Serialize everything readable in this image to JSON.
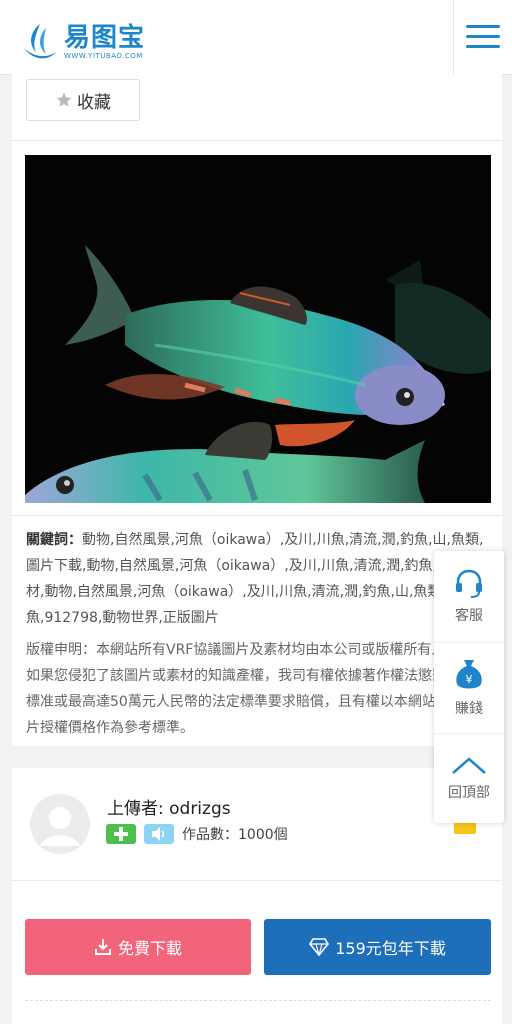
{
  "header": {
    "logo_cn": "易图宝",
    "logo_en": "WWW.YITUBAO.COM"
  },
  "favorite": {
    "label": "收藏"
  },
  "image_info": {
    "keywords_label": "關鍵詞：",
    "keywords_text": "動物,自然風景,河魚（oikawa）,及川,川魚,清流,潤,釣魚,山,魚類,圖片下載,動物,自然風景,河魚（oikawa）,及川,川魚,清流,潤,釣魚,山,魚素材,動物,自然風景,河魚（oikawa）,及川,川魚,清流,潤,釣魚,山,魚類,魚,912798,動物世界,正版圖片",
    "copyright": "版權申明：本網站所有VRF協議圖片及素材均由本公司或版權所有人發布，如果您侵犯了該圖片或素材的知識產權，我司有權依據著作權法懲罰性賠償標准或最高達50萬元人民幣的法定標準要求賠償，且有權以本網站發布的圖片授權價格作為參考標準。"
  },
  "uploader": {
    "label": "上傳者: odrizgs",
    "works": "作品數：1000個"
  },
  "actions": {
    "free_download": "免費下載",
    "year_download": "159元包年下載"
  },
  "side_panel": {
    "service": "客服",
    "earn": "賺錢",
    "top": "回頂部"
  },
  "colors": {
    "brand_blue": "#1e86c8",
    "free_btn": "#f2647a",
    "year_btn": "#1c6fb8"
  }
}
